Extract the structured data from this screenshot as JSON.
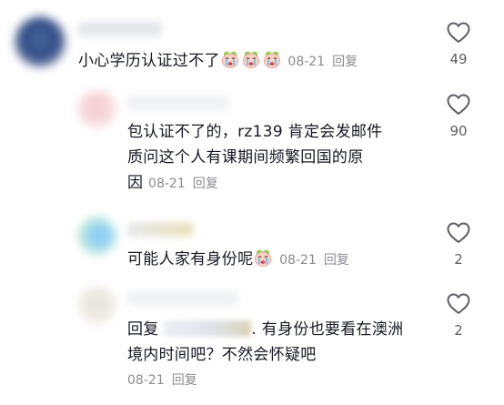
{
  "comments": [
    {
      "text": "小心学历认证过不了",
      "emoji_count": 3,
      "date": "08-21",
      "reply_label": "回复",
      "likes": "49"
    },
    {
      "text_line1": "包认证不了的，rz139 肯定会发邮件",
      "text_line2": "质问这个人有课期间频繁回国的原",
      "text_line3": "因",
      "date": "08-21",
      "reply_label": "回复",
      "likes": "90"
    },
    {
      "text": "可能人家有身份呢",
      "emoji_count": 1,
      "date": "08-21",
      "reply_label": "回复",
      "likes": "2"
    },
    {
      "reply_prefix": "回复",
      "text_line1": ". 有身份也要看在澳洲",
      "text_line2": "境内时间吧？不然会怀疑吧",
      "date": "08-21",
      "reply_label": "回复",
      "likes": "2"
    }
  ],
  "icons": {
    "like": "heart-outline-icon",
    "emoji": "crying-face-emoji"
  },
  "colors": {
    "text": "#161823",
    "meta": "#8a8b91",
    "count": "#5d5e66",
    "heart": "#5d5e66"
  }
}
